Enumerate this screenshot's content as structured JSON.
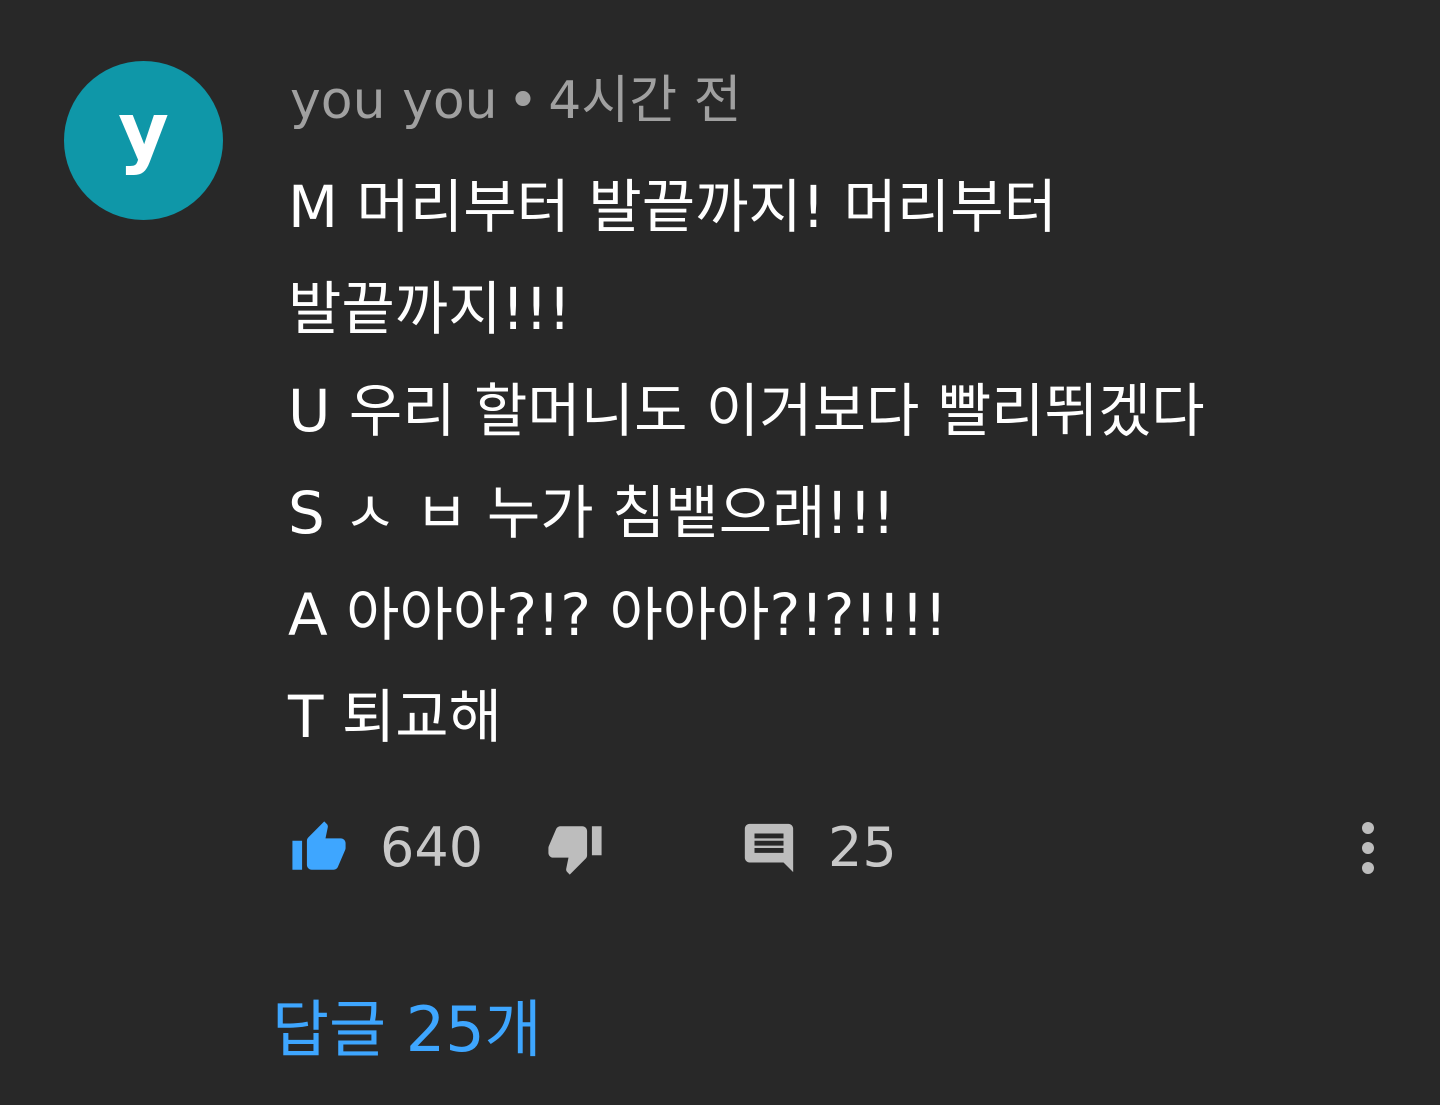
{
  "comment": {
    "avatar_letter": "y",
    "author": "you you",
    "separator": "•",
    "timestamp": "4시간 전",
    "lines": [
      "M 머리부터 발끝까지! 머리부터",
      "발끝까지!!!",
      "U 우리 할머니도 이거보다 빨리뛰겠다",
      "S ㅅ ㅂ 누가 침뱉으래!!!",
      "A 아아아?!? 아아아?!?!!!!",
      "T 퇴교해"
    ],
    "likes": "640",
    "reply_count": "25",
    "replies_link": "답글 25개"
  },
  "colors": {
    "background": "#282828",
    "avatar": "#0f97a8",
    "like_active": "#3ea6ff",
    "link": "#3ea6ff",
    "muted_text": "#a0a0a0"
  },
  "icons": {
    "like": "thumbs-up-icon",
    "dislike": "thumbs-down-icon",
    "reply": "comment-icon",
    "more": "more-vert-icon"
  }
}
